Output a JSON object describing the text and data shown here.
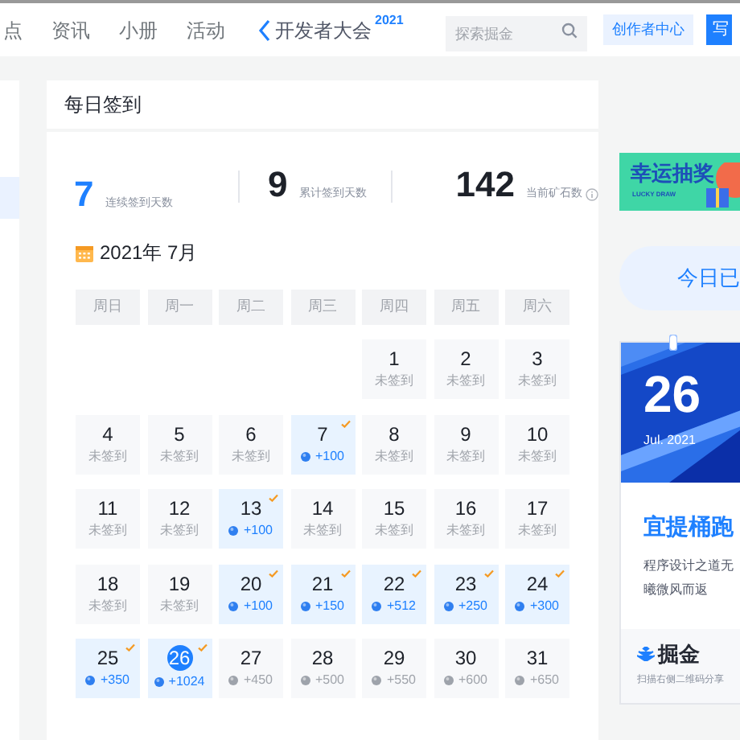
{
  "nav": {
    "items": [
      "点",
      "资讯",
      "小册",
      "活动"
    ],
    "brand": "开发者大会",
    "brand_year": "2021",
    "search": {
      "placeholder": "探索掘金"
    },
    "creator_button": "创作者中心",
    "write_button": "写"
  },
  "card": {
    "title": "每日签到",
    "stats": [
      {
        "value": "7",
        "label": "连续签到天数",
        "highlight": true,
        "info": false
      },
      {
        "value": "9",
        "label": "累计签到天数",
        "highlight": false,
        "info": false
      },
      {
        "value": "142",
        "label": "当前矿石数",
        "highlight": false,
        "info": true
      }
    ],
    "month": "2021年 7月",
    "weekdays": [
      "周日",
      "周一",
      "周二",
      "周三",
      "周四",
      "周五",
      "周六"
    ],
    "days": [
      {
        "day": "1",
        "kind": "missed",
        "text": "未签到",
        "today": false
      },
      {
        "day": "2",
        "kind": "missed",
        "text": "未签到",
        "today": false
      },
      {
        "day": "3",
        "kind": "missed",
        "text": "未签到",
        "today": false
      },
      {
        "day": "4",
        "kind": "missed",
        "text": "未签到",
        "today": false
      },
      {
        "day": "5",
        "kind": "missed",
        "text": "未签到",
        "today": false
      },
      {
        "day": "6",
        "kind": "missed",
        "text": "未签到",
        "today": false
      },
      {
        "day": "7",
        "kind": "signed",
        "text": "+100",
        "today": false
      },
      {
        "day": "8",
        "kind": "missed",
        "text": "未签到",
        "today": false
      },
      {
        "day": "9",
        "kind": "missed",
        "text": "未签到",
        "today": false
      },
      {
        "day": "10",
        "kind": "missed",
        "text": "未签到",
        "today": false
      },
      {
        "day": "11",
        "kind": "missed",
        "text": "未签到",
        "today": false
      },
      {
        "day": "12",
        "kind": "missed",
        "text": "未签到",
        "today": false
      },
      {
        "day": "13",
        "kind": "signed",
        "text": "+100",
        "today": false
      },
      {
        "day": "14",
        "kind": "missed",
        "text": "未签到",
        "today": false
      },
      {
        "day": "15",
        "kind": "missed",
        "text": "未签到",
        "today": false
      },
      {
        "day": "16",
        "kind": "missed",
        "text": "未签到",
        "today": false
      },
      {
        "day": "17",
        "kind": "missed",
        "text": "未签到",
        "today": false
      },
      {
        "day": "18",
        "kind": "missed",
        "text": "未签到",
        "today": false
      },
      {
        "day": "19",
        "kind": "missed",
        "text": "未签到",
        "today": false
      },
      {
        "day": "20",
        "kind": "signed",
        "text": "+100",
        "today": false
      },
      {
        "day": "21",
        "kind": "signed",
        "text": "+150",
        "today": false
      },
      {
        "day": "22",
        "kind": "signed",
        "text": "+512",
        "today": false
      },
      {
        "day": "23",
        "kind": "signed",
        "text": "+250",
        "today": false
      },
      {
        "day": "24",
        "kind": "signed",
        "text": "+300",
        "today": false
      },
      {
        "day": "25",
        "kind": "signed",
        "text": "+350",
        "today": false
      },
      {
        "day": "26",
        "kind": "signed",
        "text": "+1024",
        "today": true
      },
      {
        "day": "27",
        "kind": "upcoming",
        "text": "+450",
        "today": false
      },
      {
        "day": "28",
        "kind": "upcoming",
        "text": "+500",
        "today": false
      },
      {
        "day": "29",
        "kind": "upcoming",
        "text": "+550",
        "today": false
      },
      {
        "day": "30",
        "kind": "upcoming",
        "text": "+600",
        "today": false
      },
      {
        "day": "31",
        "kind": "upcoming",
        "text": "+650",
        "today": false
      }
    ]
  },
  "side": {
    "banner_title": "幸运抽奖",
    "banner_sub": "LUCKY DRAW",
    "signed_button": "今日已",
    "date_card": {
      "day": "26",
      "month": "Jul. 2021",
      "headline": "宜提桶跑",
      "text": "程序设计之道无",
      "text2": "曦微风而返",
      "brand": "掘金",
      "footer": "扫描右侧二维码分享"
    }
  }
}
